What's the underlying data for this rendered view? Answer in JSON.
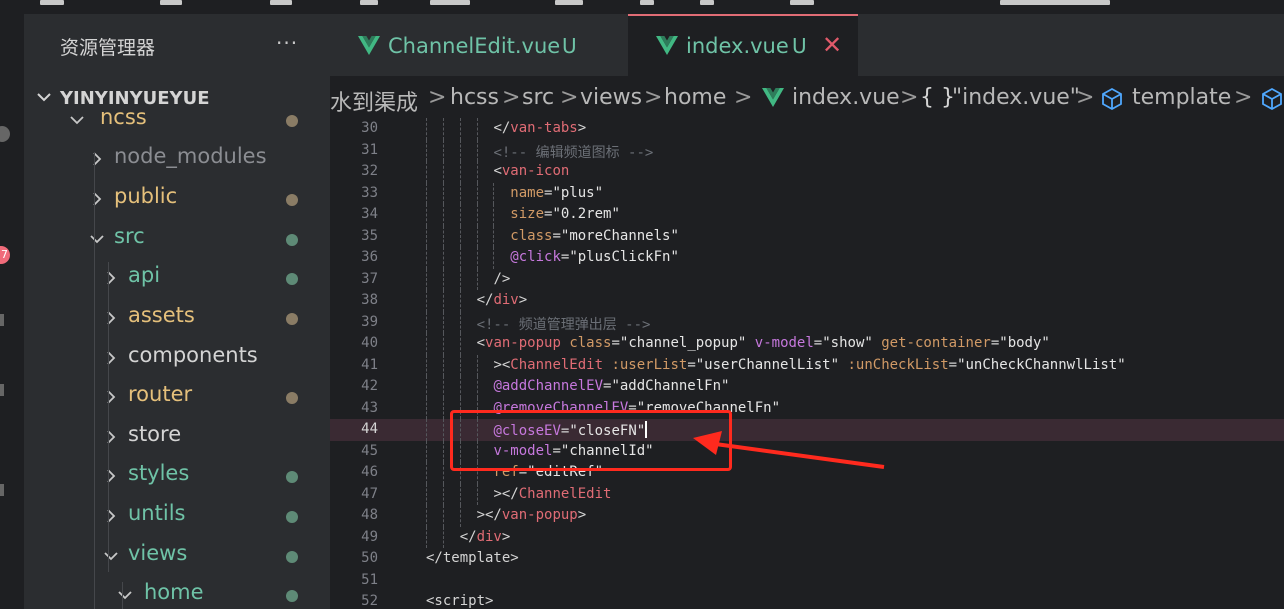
{
  "explorer": {
    "title": "资源管理器",
    "more_icon": "ellipsis-icon",
    "project": "YINYINYUEYUE",
    "tree": [
      {
        "label": "hcss",
        "expanded": true,
        "folder": true,
        "color": "#e5c07b",
        "dot": "#8a7c65"
      },
      {
        "label": "node_modules",
        "expanded": false,
        "folder": true,
        "color": "#8b8d92",
        "dot": null
      },
      {
        "label": "public",
        "expanded": false,
        "folder": true,
        "color": "#e5c07b",
        "dot": "#8a7c65"
      },
      {
        "label": "src",
        "expanded": true,
        "folder": true,
        "color": "#6fc3a7",
        "dot": "#5e8a76"
      },
      {
        "label": "api",
        "expanded": false,
        "folder": true,
        "color": "#6fc3a7",
        "dot": "#5e8a76"
      },
      {
        "label": "assets",
        "expanded": false,
        "folder": true,
        "color": "#e5c07b",
        "dot": "#8a7c65"
      },
      {
        "label": "components",
        "expanded": false,
        "folder": true,
        "color": "#d4d4d4",
        "dot": null
      },
      {
        "label": "router",
        "expanded": false,
        "folder": true,
        "color": "#e5c07b",
        "dot": "#8a7c65"
      },
      {
        "label": "store",
        "expanded": false,
        "folder": true,
        "color": "#d4d4d4",
        "dot": null
      },
      {
        "label": "styles",
        "expanded": false,
        "folder": true,
        "color": "#6fc3a7",
        "dot": "#5e8a76"
      },
      {
        "label": "untils",
        "expanded": false,
        "folder": true,
        "color": "#6fc3a7",
        "dot": "#5e8a76"
      },
      {
        "label": "views",
        "expanded": true,
        "folder": true,
        "color": "#6fc3a7",
        "dot": "#5e8a76"
      },
      {
        "label": "home",
        "expanded": true,
        "folder": true,
        "color": "#6fc3a7",
        "dot": "#5e8a76"
      }
    ]
  },
  "tabs": [
    {
      "label": "ChannelEdit.vue",
      "status": "U",
      "active": false,
      "icon": "vue-icon"
    },
    {
      "label": "index.vue",
      "status": "U",
      "active": true,
      "icon": "vue-icon",
      "close_icon": "close-icon"
    }
  ],
  "breadcrumb": {
    "items": [
      "水到渠成",
      "hcss",
      "src",
      "views",
      "home",
      "index.vue",
      "\"index.vue\"",
      "template"
    ],
    "braces": "{ }",
    "separator": ">"
  },
  "colors": {
    "accent_tab": "#e06c75",
    "vue_green": "#6fc3a7",
    "annotation_red": "#ff2a1e",
    "current_line_bg": "#3a2a33"
  },
  "editor": {
    "current_line": 44,
    "lines": [
      {
        "n": 30,
        "g": 4,
        "segs": [
          [
            "t-punc",
            "</"
          ],
          [
            "t-tag",
            "van-tabs"
          ],
          [
            "t-punc",
            ">"
          ]
        ]
      },
      {
        "n": 31,
        "g": 4,
        "segs": [
          [
            "t-cmt",
            "<!-- 编辑频道图标 -->"
          ]
        ]
      },
      {
        "n": 32,
        "g": 4,
        "segs": [
          [
            "t-punc",
            "<"
          ],
          [
            "t-tag",
            "van-icon"
          ]
        ]
      },
      {
        "n": 33,
        "g": 5,
        "segs": [
          [
            "t-attr",
            "name"
          ],
          [
            "t-punc",
            "="
          ],
          [
            "t-str",
            "\"plus\""
          ]
        ]
      },
      {
        "n": 34,
        "g": 5,
        "segs": [
          [
            "t-attr",
            "size"
          ],
          [
            "t-punc",
            "="
          ],
          [
            "t-str",
            "\"0.2rem\""
          ]
        ]
      },
      {
        "n": 35,
        "g": 5,
        "segs": [
          [
            "t-attr",
            "class"
          ],
          [
            "t-punc",
            "="
          ],
          [
            "t-str",
            "\"moreChannels\""
          ]
        ]
      },
      {
        "n": 36,
        "g": 5,
        "segs": [
          [
            "t-dir",
            "@click"
          ],
          [
            "t-punc",
            "="
          ],
          [
            "t-str",
            "\"plusClickFn\""
          ]
        ]
      },
      {
        "n": 37,
        "g": 4,
        "segs": [
          [
            "t-punc",
            "/>"
          ]
        ]
      },
      {
        "n": 38,
        "g": 3,
        "segs": [
          [
            "t-punc",
            "</"
          ],
          [
            "t-tag",
            "div"
          ],
          [
            "t-punc",
            ">"
          ]
        ]
      },
      {
        "n": 39,
        "g": 3,
        "segs": [
          [
            "t-cmt",
            "<!-- 频道管理弹出层 -->"
          ]
        ]
      },
      {
        "n": 40,
        "g": 3,
        "segs": [
          [
            "t-punc",
            "<"
          ],
          [
            "t-tag",
            "van-popup"
          ],
          [
            "t-punc",
            " "
          ],
          [
            "t-attr",
            "class"
          ],
          [
            "t-punc",
            "="
          ],
          [
            "t-str",
            "\"channel_popup\""
          ],
          [
            "t-punc",
            " "
          ],
          [
            "t-dir",
            "v-model"
          ],
          [
            "t-punc",
            "="
          ],
          [
            "t-str",
            "\"show\""
          ],
          [
            "t-punc",
            " "
          ],
          [
            "t-attr",
            "get-container"
          ],
          [
            "t-punc",
            "="
          ],
          [
            "t-str",
            "\"body\""
          ]
        ]
      },
      {
        "n": 41,
        "g": 4,
        "segs": [
          [
            "t-punc",
            "><"
          ],
          [
            "t-tag",
            "ChannelEdit"
          ],
          [
            "t-punc",
            " "
          ],
          [
            "t-attr",
            ":userList"
          ],
          [
            "t-punc",
            "="
          ],
          [
            "t-str",
            "\"userChannelList\""
          ],
          [
            "t-punc",
            " "
          ],
          [
            "t-attr",
            ":unCheckList"
          ],
          [
            "t-punc",
            "="
          ],
          [
            "t-str",
            "\"unCheckChannwlList\""
          ]
        ]
      },
      {
        "n": 42,
        "g": 4,
        "segs": [
          [
            "t-dir",
            "@addChannelEV"
          ],
          [
            "t-punc",
            "="
          ],
          [
            "t-str",
            "\"addChannelFn\""
          ]
        ]
      },
      {
        "n": 43,
        "g": 4,
        "segs": [
          [
            "t-dir",
            "@removeChannelEV"
          ],
          [
            "t-punc",
            "="
          ],
          [
            "t-str",
            "\"removeChannelFn\""
          ]
        ]
      },
      {
        "n": 44,
        "g": 4,
        "segs": [
          [
            "t-dir",
            "@closeEV"
          ],
          [
            "t-punc",
            "="
          ],
          [
            "t-str",
            "\"closeFN\""
          ]
        ],
        "cursor": true
      },
      {
        "n": 45,
        "g": 4,
        "segs": [
          [
            "t-dir",
            "v-model"
          ],
          [
            "t-punc",
            "="
          ],
          [
            "t-str",
            "\"channelId\""
          ]
        ]
      },
      {
        "n": 46,
        "g": 4,
        "segs": [
          [
            "t-attr",
            "ref"
          ],
          [
            "t-punc",
            "="
          ],
          [
            "t-str",
            "\"editRef\""
          ]
        ]
      },
      {
        "n": 47,
        "g": 4,
        "segs": [
          [
            "t-punc",
            "></"
          ],
          [
            "t-tag",
            "ChannelEdit"
          ]
        ]
      },
      {
        "n": 48,
        "g": 3,
        "segs": [
          [
            "t-punc",
            "></"
          ],
          [
            "t-tag",
            "van-popup"
          ],
          [
            "t-punc",
            ">"
          ]
        ]
      },
      {
        "n": 49,
        "g": 2,
        "segs": [
          [
            "t-punc",
            "</"
          ],
          [
            "t-tag",
            "div"
          ],
          [
            "t-punc",
            ">"
          ]
        ]
      },
      {
        "n": 50,
        "g": 0,
        "segs": [
          [
            "t-punc",
            "</template>"
          ]
        ]
      },
      {
        "n": 51,
        "g": 0,
        "segs": []
      },
      {
        "n": 52,
        "g": 0,
        "segs": [
          [
            "t-punc",
            "<script>"
          ]
        ]
      }
    ]
  }
}
